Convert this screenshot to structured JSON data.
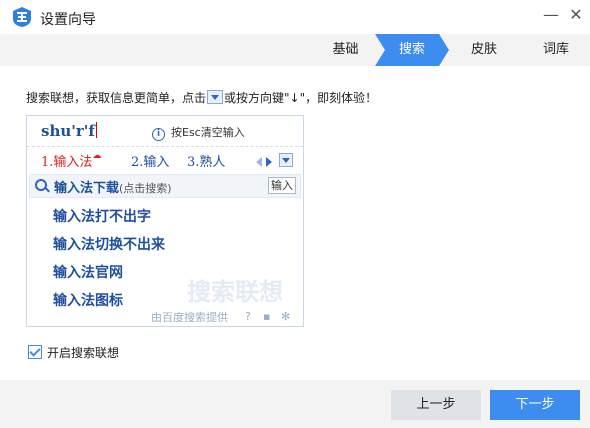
{
  "window": {
    "title": "设置向导",
    "minimize_glyph": "—",
    "close_glyph": "✕"
  },
  "steps": [
    {
      "label": "基础",
      "active": false
    },
    {
      "label": "搜索",
      "active": true
    },
    {
      "label": "皮肤",
      "active": false
    },
    {
      "label": "词库",
      "active": false
    }
  ],
  "description": {
    "part1": "搜索联想，获取信息更简单，点击",
    "part2": "或按方向键\"↓\"，即刻体验！"
  },
  "preview": {
    "pinyin": "shu'r'f",
    "esc_hint": "按Esc清空输入",
    "candidates": [
      "1.输入法",
      "2.输入",
      "3.熟人"
    ],
    "search_term": "输入法下载",
    "search_hint": "(点击搜索)",
    "input_tag": "输入",
    "suggestions": [
      "输入法打不出字",
      "输入法切换不出来",
      "输入法官网",
      "输入法图标"
    ],
    "watermark": "搜索联想",
    "provided_by": "由百度搜索提供",
    "help_glyph": "?",
    "chat_glyph": "▪",
    "settings_glyph": "✻"
  },
  "checkbox": {
    "label": "开启搜索联想",
    "checked": true
  },
  "buttons": {
    "prev": "上一步",
    "next": "下一步"
  },
  "colors": {
    "accent": "#3d8cf0",
    "text_blue": "#1f4f9c",
    "candidate_red": "#dd2222"
  }
}
